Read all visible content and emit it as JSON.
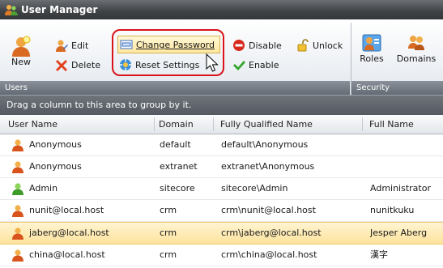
{
  "window": {
    "title": "User Manager"
  },
  "ribbon": {
    "users_group": {
      "label": "Users",
      "new": "New",
      "edit": "Edit",
      "delete": "Delete",
      "change_password": "Change Password",
      "reset_settings": "Reset Settings",
      "disable": "Disable",
      "enable": "Enable",
      "unlock": "Unlock"
    },
    "security_group": {
      "label": "Security",
      "roles": "Roles",
      "domains": "Domains"
    }
  },
  "grid": {
    "group_hint": "Drag a column to this area to group by it.",
    "columns": [
      "User Name",
      "Domain",
      "Fully Qualified Name",
      "Full Name"
    ],
    "rows": [
      {
        "user": "Anonymous",
        "domain": "default",
        "fqn": "default\\Anonymous",
        "full": "",
        "icon": "user-orange-icon"
      },
      {
        "user": "Anonymous",
        "domain": "extranet",
        "fqn": "extranet\\Anonymous",
        "full": "",
        "icon": "user-orange-icon"
      },
      {
        "user": "Admin",
        "domain": "sitecore",
        "fqn": "sitecore\\Admin",
        "full": "Administrator",
        "icon": "user-green-icon"
      },
      {
        "user": "nunit@local.host",
        "domain": "crm",
        "fqn": "crm\\nunit@local.host",
        "full": "nunitkuku",
        "icon": "user-orange-icon"
      },
      {
        "user": "jaberg@local.host",
        "domain": "crm",
        "fqn": "crm\\jaberg@local.host",
        "full": "Jesper Aberg",
        "icon": "user-orange-icon",
        "selected": true
      },
      {
        "user": "china@local.host",
        "domain": "crm",
        "fqn": "crm\\china@local.host",
        "full": "漢字",
        "icon": "user-orange-icon"
      }
    ]
  },
  "colors": {
    "highlight": "#d9141a",
    "selected_row": "#fde39c",
    "titlebar": "#3f4245"
  }
}
